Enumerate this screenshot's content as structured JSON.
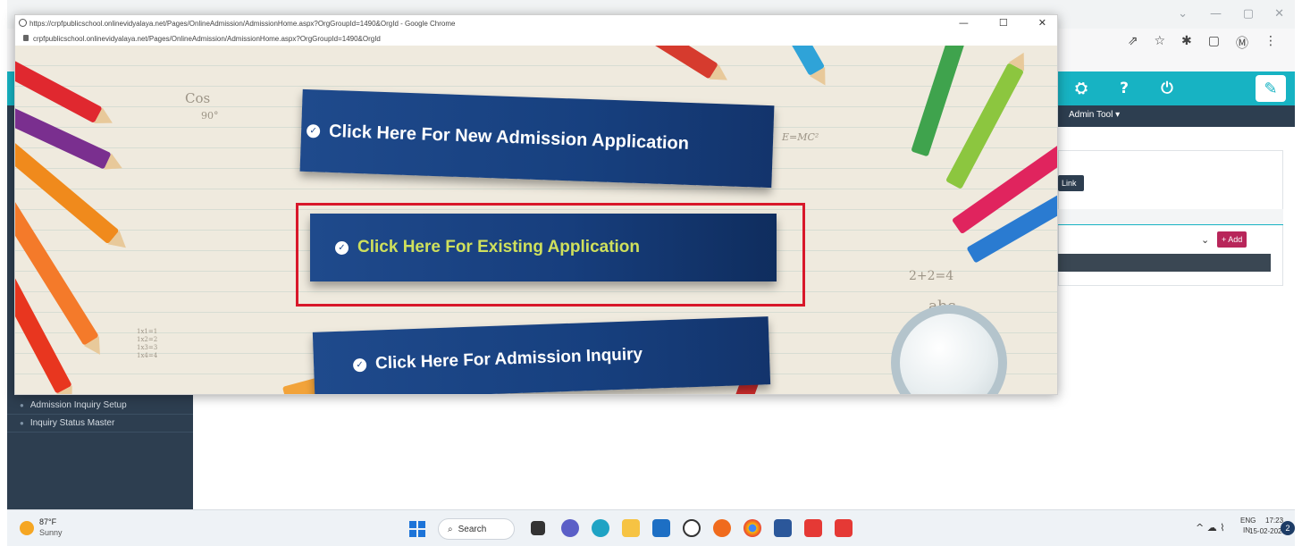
{
  "popup": {
    "title": "https://crpfpublicschool.onlinevidyalaya.net/Pages/OnlineAdmission/AdmissionHome.aspx?OrgGroupId=1490&OrgId - Google Chrome",
    "url": "crpfpublicschool.onlinevidyalaya.net/Pages/OnlineAdmission/AdmissionHome.aspx?OrgGroupId=1490&OrgId",
    "window_controls": {
      "minimize": "—",
      "maximize": "☐",
      "close": "✕"
    },
    "banners": {
      "new_admission": "Click Here For New Admission Application",
      "existing_application": "Click Here For Existing Application",
      "admission_inquiry": "Click Here For Admission Inquiry"
    },
    "doodles": {
      "cos": "Cos",
      "ninety": "90°",
      "emc2": "E=MC²",
      "sum": "2+2=4",
      "abc": "abc",
      "times": "1x1=1\n1x2=2\n1x3=3\n1x4=4"
    },
    "tick_glyph": "✓"
  },
  "background_app": {
    "menu_admin_tool": "Admin Tool ▾",
    "link_button": "Link",
    "add_button": "Add",
    "add_plus": "+",
    "select_chevron": "⌄",
    "sidebar_items": [
      "Admission Inquiry Setup",
      "Inquiry Status Master"
    ],
    "header_icons": [
      "bell-icon",
      "graduation-cap-icon",
      "help-icon",
      "power-icon"
    ],
    "header_icon_glyphs": [
      "🔔",
      "⛭",
      "?",
      "⏻"
    ],
    "browser_icons": [
      "⇗",
      "☆",
      "✱",
      "▢",
      "Ⓜ",
      "⋮"
    ],
    "browser_controls": [
      "⌄",
      "—",
      "▢",
      "✕"
    ]
  },
  "taskbar": {
    "temperature": "87°F",
    "weather": "Sunny",
    "search_label": "Search",
    "search_icon": "⌕",
    "tray_icons": "^ ☁ ⌇",
    "lang_top": "ENG",
    "lang_bottom": "IN",
    "time": "17:23",
    "date": "15-02-2023",
    "notification_count": "2",
    "accent_colors": {
      "teal_header": "#17b3c3",
      "navy_banner": "#1f4a8c",
      "highlight_red": "#d8182a",
      "existing_text": "#cfe05c"
    }
  }
}
